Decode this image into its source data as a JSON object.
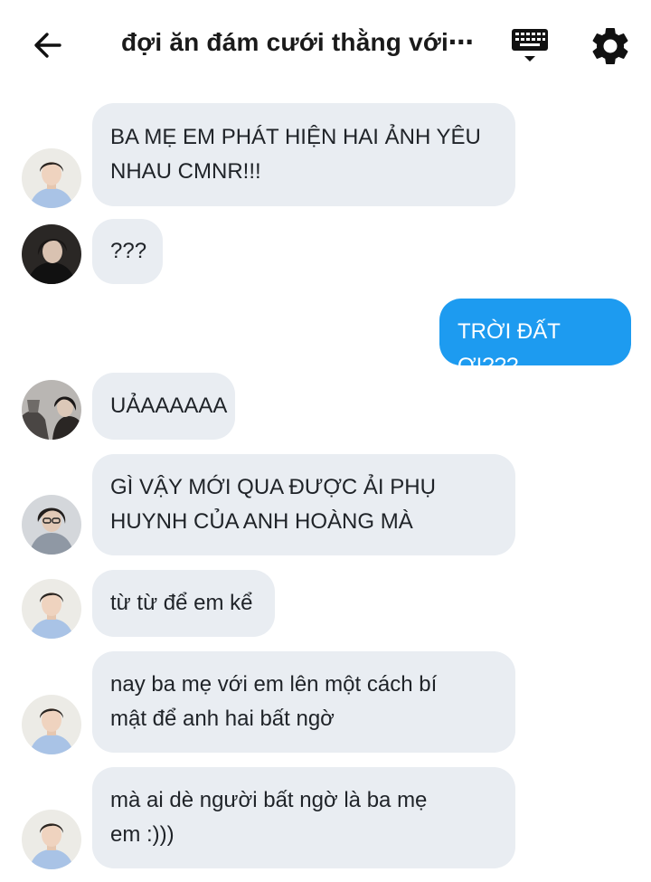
{
  "header": {
    "title": "đợi ăn đám cưới thằng với⋯"
  },
  "icons": {
    "back": "arrow-left-icon",
    "keyboard": "keyboard-icon",
    "settings": "gear-icon"
  },
  "colors": {
    "bubble_incoming": "#e9edf2",
    "bubble_outgoing": "#1d9bf0"
  },
  "messages": [
    {
      "sender": "other",
      "lines": [
        "BA MẸ EM PHÁT HIỆN HAI ẢNH YÊU",
        "NHAU CMNR!!!"
      ]
    },
    {
      "sender": "other",
      "lines": [
        "???"
      ]
    },
    {
      "sender": "me",
      "lines": [
        "TRỜI ĐẤT ƠI???"
      ]
    },
    {
      "sender": "other",
      "lines": [
        "UẢAAAAAA"
      ]
    },
    {
      "sender": "other",
      "lines": [
        "GÌ VẬY MỚI QUA ĐƯỢC ẢI PHỤ",
        "HUYNH CỦA ANH HOÀNG MÀ"
      ]
    },
    {
      "sender": "other",
      "lines": [
        "từ từ để em kể"
      ]
    },
    {
      "sender": "other",
      "lines": [
        "nay ba mẹ với em lên một cách bí",
        "mật để anh hai bất ngờ"
      ]
    },
    {
      "sender": "other",
      "lines": [
        "mà ai dè người bất ngờ là ba mẹ",
        "em :)))"
      ]
    }
  ]
}
